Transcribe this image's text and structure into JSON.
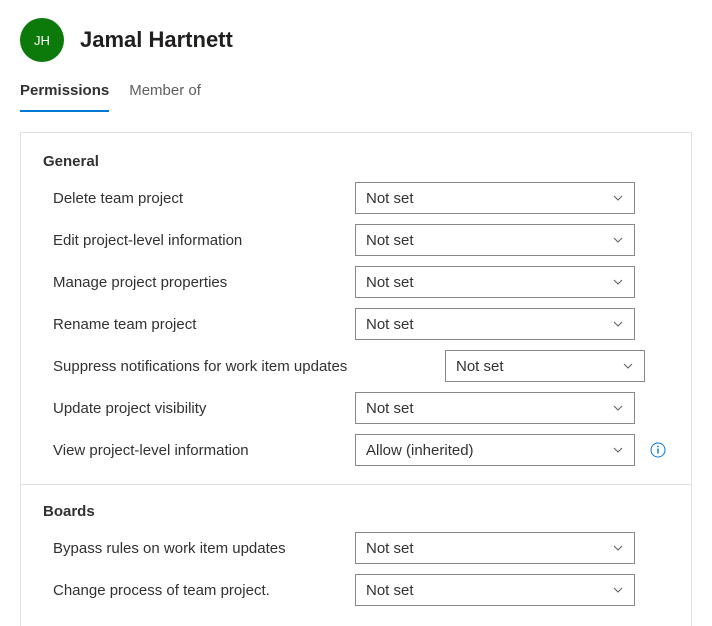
{
  "user": {
    "initials": "JH",
    "name": "Jamal Hartnett"
  },
  "tabs": {
    "permissions": "Permissions",
    "memberOf": "Member of"
  },
  "sections": {
    "general": {
      "title": "General",
      "permissions": [
        {
          "label": "Delete team project",
          "value": "Not set",
          "wide": false,
          "info": false
        },
        {
          "label": "Edit project-level information",
          "value": "Not set",
          "wide": false,
          "info": false
        },
        {
          "label": "Manage project properties",
          "value": "Not set",
          "wide": false,
          "info": false
        },
        {
          "label": "Rename team project",
          "value": "Not set",
          "wide": false,
          "info": false
        },
        {
          "label": "Suppress notifications for work item updates",
          "value": "Not set",
          "wide": true,
          "info": false
        },
        {
          "label": "Update project visibility",
          "value": "Not set",
          "wide": false,
          "info": false
        },
        {
          "label": "View project-level information",
          "value": "Allow (inherited)",
          "wide": false,
          "info": true
        }
      ]
    },
    "boards": {
      "title": "Boards",
      "permissions": [
        {
          "label": "Bypass rules on work item updates",
          "value": "Not set",
          "wide": false,
          "info": false
        },
        {
          "label": "Change process of team project.",
          "value": "Not set",
          "wide": false,
          "info": false
        }
      ]
    }
  }
}
